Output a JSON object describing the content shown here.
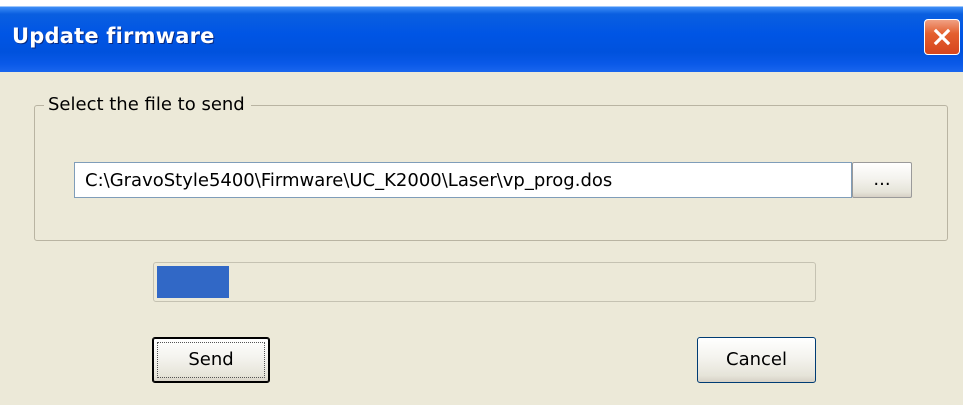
{
  "window": {
    "title": "Update firmware",
    "close_icon": "close-icon"
  },
  "file_group": {
    "legend": "Select the file to send",
    "path_value": "C:\\GravoStyle5400\\Firmware\\UC_K2000\\Laser\\vp_prog.dos",
    "browse_label": "..."
  },
  "progress": {
    "value": 0.11,
    "fill_color": "#3168c6"
  },
  "buttons": {
    "send_label": "Send",
    "cancel_label": "Cancel"
  },
  "colors": {
    "title_bar": "#0055e5",
    "dialog_background": "#ece9d8",
    "close_button": "#e4602f"
  }
}
